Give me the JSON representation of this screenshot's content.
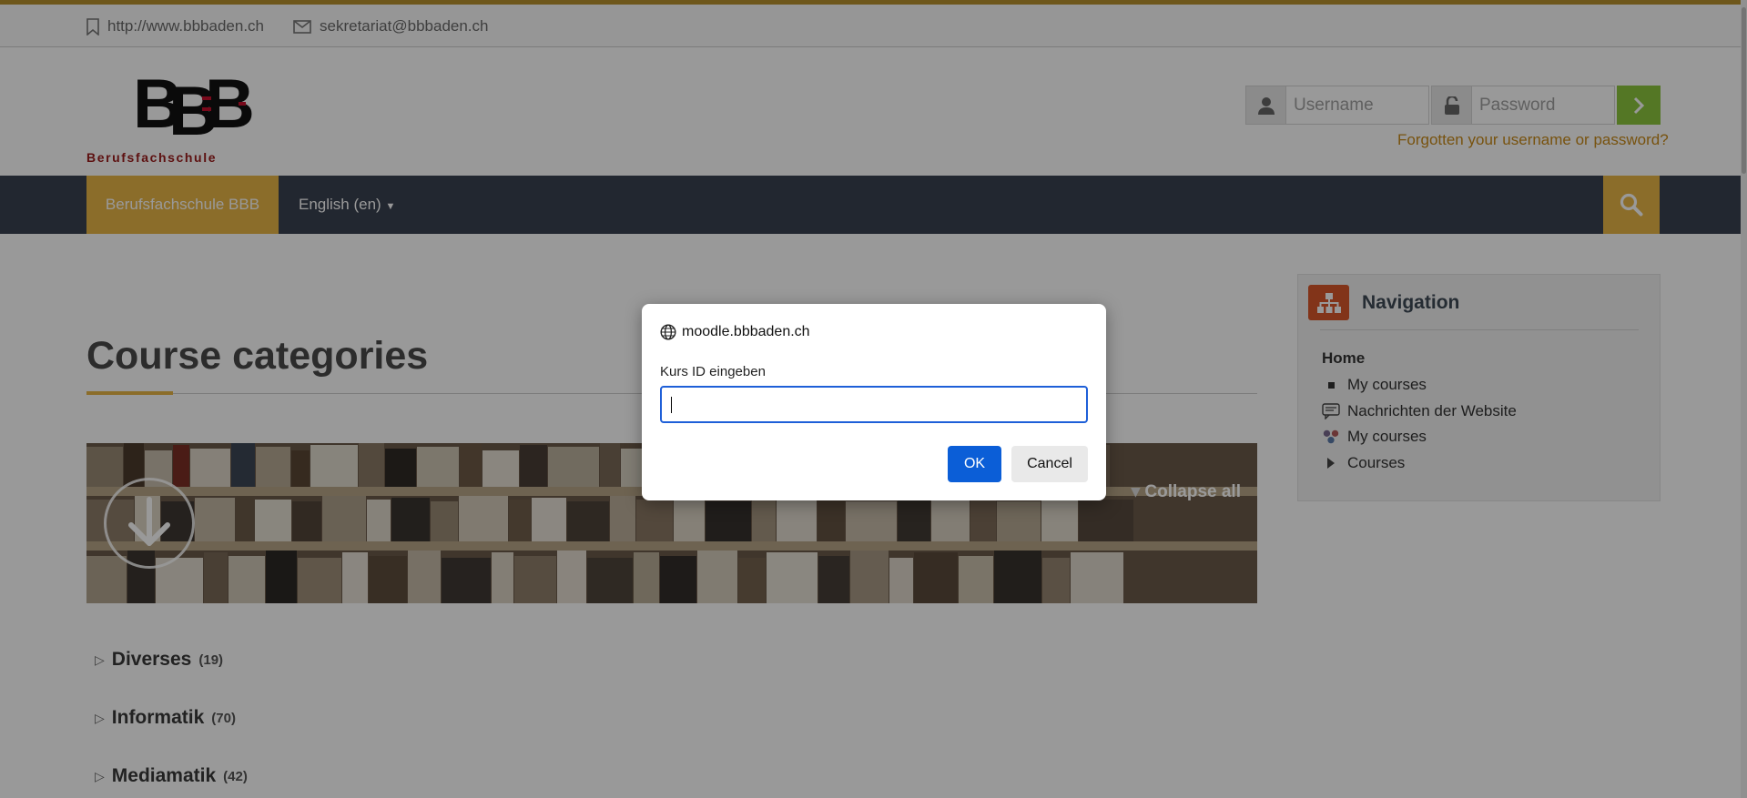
{
  "topbar": {
    "website": "http://www.bbbaden.ch",
    "email": "sekretariat@bbbaden.ch"
  },
  "logo": {
    "subtitle": "Berufsfachschule"
  },
  "login": {
    "username_placeholder": "Username",
    "password_placeholder": "Password",
    "forgot_link": "Forgotten your username or password?"
  },
  "navbar": {
    "home_label": "Berufsfachschule BBB",
    "language_label": "English (en)"
  },
  "main": {
    "page_title": "Course categories",
    "collapse_all": "Collapse all",
    "categories": [
      {
        "name": "Diverses",
        "count": "(19)"
      },
      {
        "name": "Informatik",
        "count": "(70)"
      },
      {
        "name": "Mediamatik",
        "count": "(42)"
      }
    ]
  },
  "navigation_block": {
    "title": "Navigation",
    "home": "Home",
    "items": [
      {
        "label": "My courses",
        "icon": "bullet-icon"
      },
      {
        "label": "Nachrichten der Website",
        "icon": "forum-icon"
      },
      {
        "label": "My courses",
        "icon": "courses-icon"
      },
      {
        "label": "Courses",
        "icon": "expand-arrow-icon"
      }
    ]
  },
  "dialog": {
    "origin": "moodle.bbbaden.ch",
    "prompt_label": "Kurs ID eingeben",
    "input_value": "",
    "ok_label": "OK",
    "cancel_label": "Cancel"
  },
  "colors": {
    "accent_gold": "#e8b646",
    "navbar_bg": "#3a4150",
    "login_button": "#8cc63f",
    "dialog_primary": "#0b5ed7",
    "nav_badge": "#d9582b"
  }
}
